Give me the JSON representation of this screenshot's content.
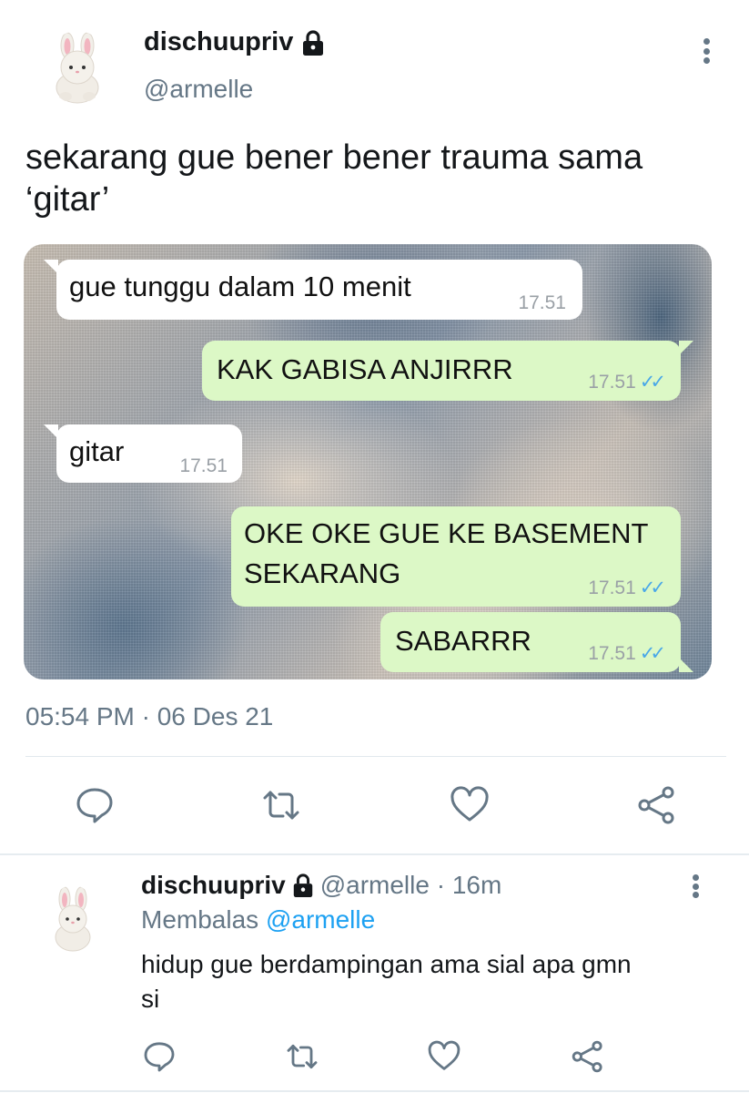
{
  "tweet": {
    "display_name": "dischuupriv",
    "handle": "@armelle",
    "text": "sekarang gue bener bener trauma sama ‘gitar’",
    "timestamp": "05:54 PM · 06 Des 21",
    "icons": {
      "avatar": "bunny-plush-avatar",
      "protected": "lock-icon",
      "more": "more-vertical-icon",
      "reply": "reply-icon",
      "retweet": "retweet-icon",
      "like": "heart-icon",
      "share": "share-icon"
    }
  },
  "chat": {
    "messages": [
      {
        "direction": "incoming",
        "text": "gue tunggu dalam 10 menit",
        "time": "17.51",
        "read": false
      },
      {
        "direction": "outgoing",
        "text": "KAK GABISA ANJIRRR",
        "time": "17.51",
        "read": true
      },
      {
        "direction": "incoming",
        "text": "gitar",
        "time": "17.51",
        "read": false
      },
      {
        "direction": "outgoing",
        "text_lines": [
          "OKE OKE GUE KE BASEMENT",
          "SEKARANG"
        ],
        "time": "17.51",
        "read": true
      },
      {
        "direction": "outgoing",
        "text": "SABARRR",
        "time": "17.51",
        "read": true
      }
    ],
    "read_ticks": "✓✓",
    "colors": {
      "incoming": "#ffffff",
      "outgoing": "#dcf8c6",
      "ticks": "#4aa8e8"
    }
  },
  "reply": {
    "display_name": "dischuupriv",
    "handle_time": "@armelle · 16m",
    "replying_to_prefix": "Membalas",
    "replying_to_mention": "@armelle",
    "text": "hidup gue berdampingan ama sial apa gmn si"
  },
  "colors": {
    "primary_text": "#14171a",
    "secondary_text": "#657786",
    "link": "#1da1f2",
    "divider": "#e1e8ed"
  }
}
